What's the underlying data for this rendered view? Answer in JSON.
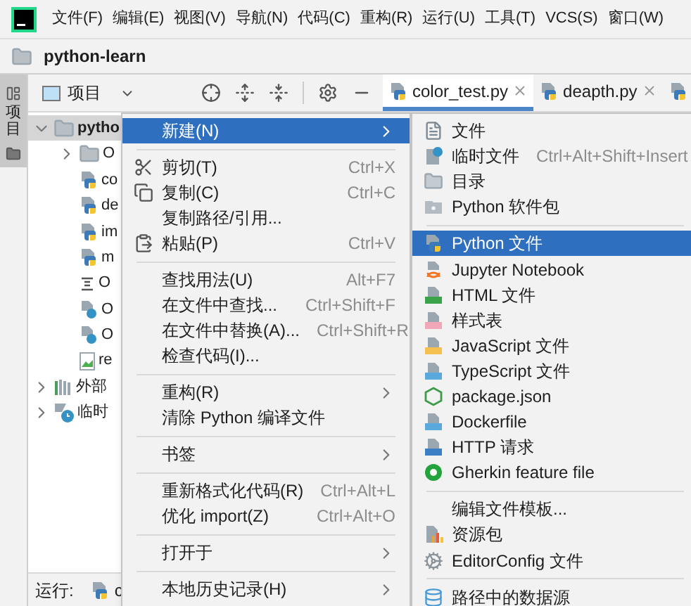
{
  "menu_bar": [
    "文件(F)",
    "编辑(E)",
    "视图(V)",
    "导航(N)",
    "代码(C)",
    "重构(R)",
    "运行(U)",
    "工具(T)",
    "VCS(S)",
    "窗口(W)"
  ],
  "breadcrumb": "python-learn",
  "tool_stripe": {
    "label": "项目",
    "selected": true
  },
  "project_panel": {
    "title": "项目"
  },
  "editor_tabs": [
    {
      "label": "color_test.py",
      "selected": true
    },
    {
      "label": "deapth.py",
      "selected": false
    },
    {
      "selected": false
    }
  ],
  "tree": [
    {
      "label": "pytho",
      "kind": "folder",
      "expanded": true,
      "children": [
        {
          "label": "O",
          "kind": "folder",
          "expanded": false
        },
        {
          "label": "co",
          "kind": "python"
        },
        {
          "label": "de",
          "kind": "python"
        },
        {
          "label": "im",
          "kind": "python"
        },
        {
          "label": "m",
          "kind": "python"
        },
        {
          "label": "O",
          "kind": "text"
        },
        {
          "label": "O",
          "kind": "unknown"
        },
        {
          "label": "O",
          "kind": "unknown"
        },
        {
          "label": "re",
          "kind": "image"
        }
      ]
    },
    {
      "label": "外部",
      "kind": "library",
      "expanded": false
    },
    {
      "label": "临时",
      "kind": "scratch",
      "expanded": false
    }
  ],
  "run_bar": {
    "label": "运行:",
    "config": "c"
  },
  "context_menu": [
    {
      "kind": "plain",
      "label": "新建(N)",
      "selected": true,
      "submenu": true
    },
    {
      "kind": "separator"
    },
    {
      "kind": "cut",
      "label": "剪切(T)",
      "shortcut": "Ctrl+X",
      "selected": false
    },
    {
      "kind": "copy",
      "label": "复制(C)",
      "shortcut": "Ctrl+C",
      "selected": false
    },
    {
      "kind": "plain",
      "label": "复制路径/引用...",
      "selected": false
    },
    {
      "kind": "paste",
      "label": "粘贴(P)",
      "shortcut": "Ctrl+V",
      "selected": false
    },
    {
      "kind": "separator"
    },
    {
      "kind": "plain",
      "label": "查找用法(U)",
      "shortcut": "Alt+F7",
      "selected": false
    },
    {
      "kind": "plain",
      "label": "在文件中查找...",
      "shortcut": "Ctrl+Shift+F",
      "selected": false
    },
    {
      "kind": "plain",
      "label": "在文件中替换(A)...",
      "shortcut": "Ctrl+Shift+R",
      "selected": false
    },
    {
      "kind": "plain",
      "label": "检查代码(I)...",
      "selected": false
    },
    {
      "kind": "separator"
    },
    {
      "kind": "plain",
      "label": "重构(R)",
      "selected": false,
      "submenu": true
    },
    {
      "kind": "plain",
      "label": "清除 Python 编译文件",
      "selected": false
    },
    {
      "kind": "separator"
    },
    {
      "kind": "plain",
      "label": "书签",
      "selected": false,
      "submenu": true
    },
    {
      "kind": "separator"
    },
    {
      "kind": "plain",
      "label": "重新格式化代码(R)",
      "shortcut": "Ctrl+Alt+L",
      "selected": false
    },
    {
      "kind": "plain",
      "label": "优化 import(Z)",
      "shortcut": "Ctrl+Alt+O",
      "selected": false
    },
    {
      "kind": "separator"
    },
    {
      "kind": "plain",
      "label": "打开于",
      "selected": false,
      "submenu": true
    },
    {
      "kind": "separator"
    },
    {
      "kind": "plain",
      "label": "本地历史记录(H)",
      "selected": false,
      "submenu": true
    }
  ],
  "new_submenu": [
    {
      "kind": "file",
      "label": "文件",
      "selected": false
    },
    {
      "kind": "scratch",
      "label": "临时文件",
      "shortcut": "Ctrl+Alt+Shift+Insert",
      "selected": false
    },
    {
      "kind": "folder",
      "label": "目录",
      "selected": false
    },
    {
      "kind": "package",
      "label": "Python 软件包",
      "selected": false
    },
    {
      "kind": "separator"
    },
    {
      "kind": "python",
      "label": "Python 文件",
      "selected": true
    },
    {
      "kind": "jupyter",
      "label": "Jupyter Notebook",
      "selected": false
    },
    {
      "kind": "html",
      "label": "HTML 文件",
      "selected": false
    },
    {
      "kind": "css",
      "label": "样式表",
      "selected": false
    },
    {
      "kind": "js",
      "label": "JavaScript 文件",
      "selected": false
    },
    {
      "kind": "ts",
      "label": "TypeScript 文件",
      "selected": false
    },
    {
      "kind": "npm",
      "label": "package.json",
      "selected": false
    },
    {
      "kind": "docker",
      "label": "Dockerfile",
      "selected": false
    },
    {
      "kind": "http",
      "label": "HTTP 请求",
      "selected": false
    },
    {
      "kind": "gherkin",
      "label": "Gherkin feature file",
      "selected": false
    },
    {
      "kind": "separator"
    },
    {
      "kind": "plain",
      "label": "编辑文件模板...",
      "selected": false
    },
    {
      "kind": "bundle",
      "label": "资源包",
      "selected": false
    },
    {
      "kind": "gear",
      "label": "EditorConfig 文件",
      "selected": false
    },
    {
      "kind": "separator"
    },
    {
      "kind": "database",
      "label": "路径中的数据源",
      "selected": false
    }
  ]
}
